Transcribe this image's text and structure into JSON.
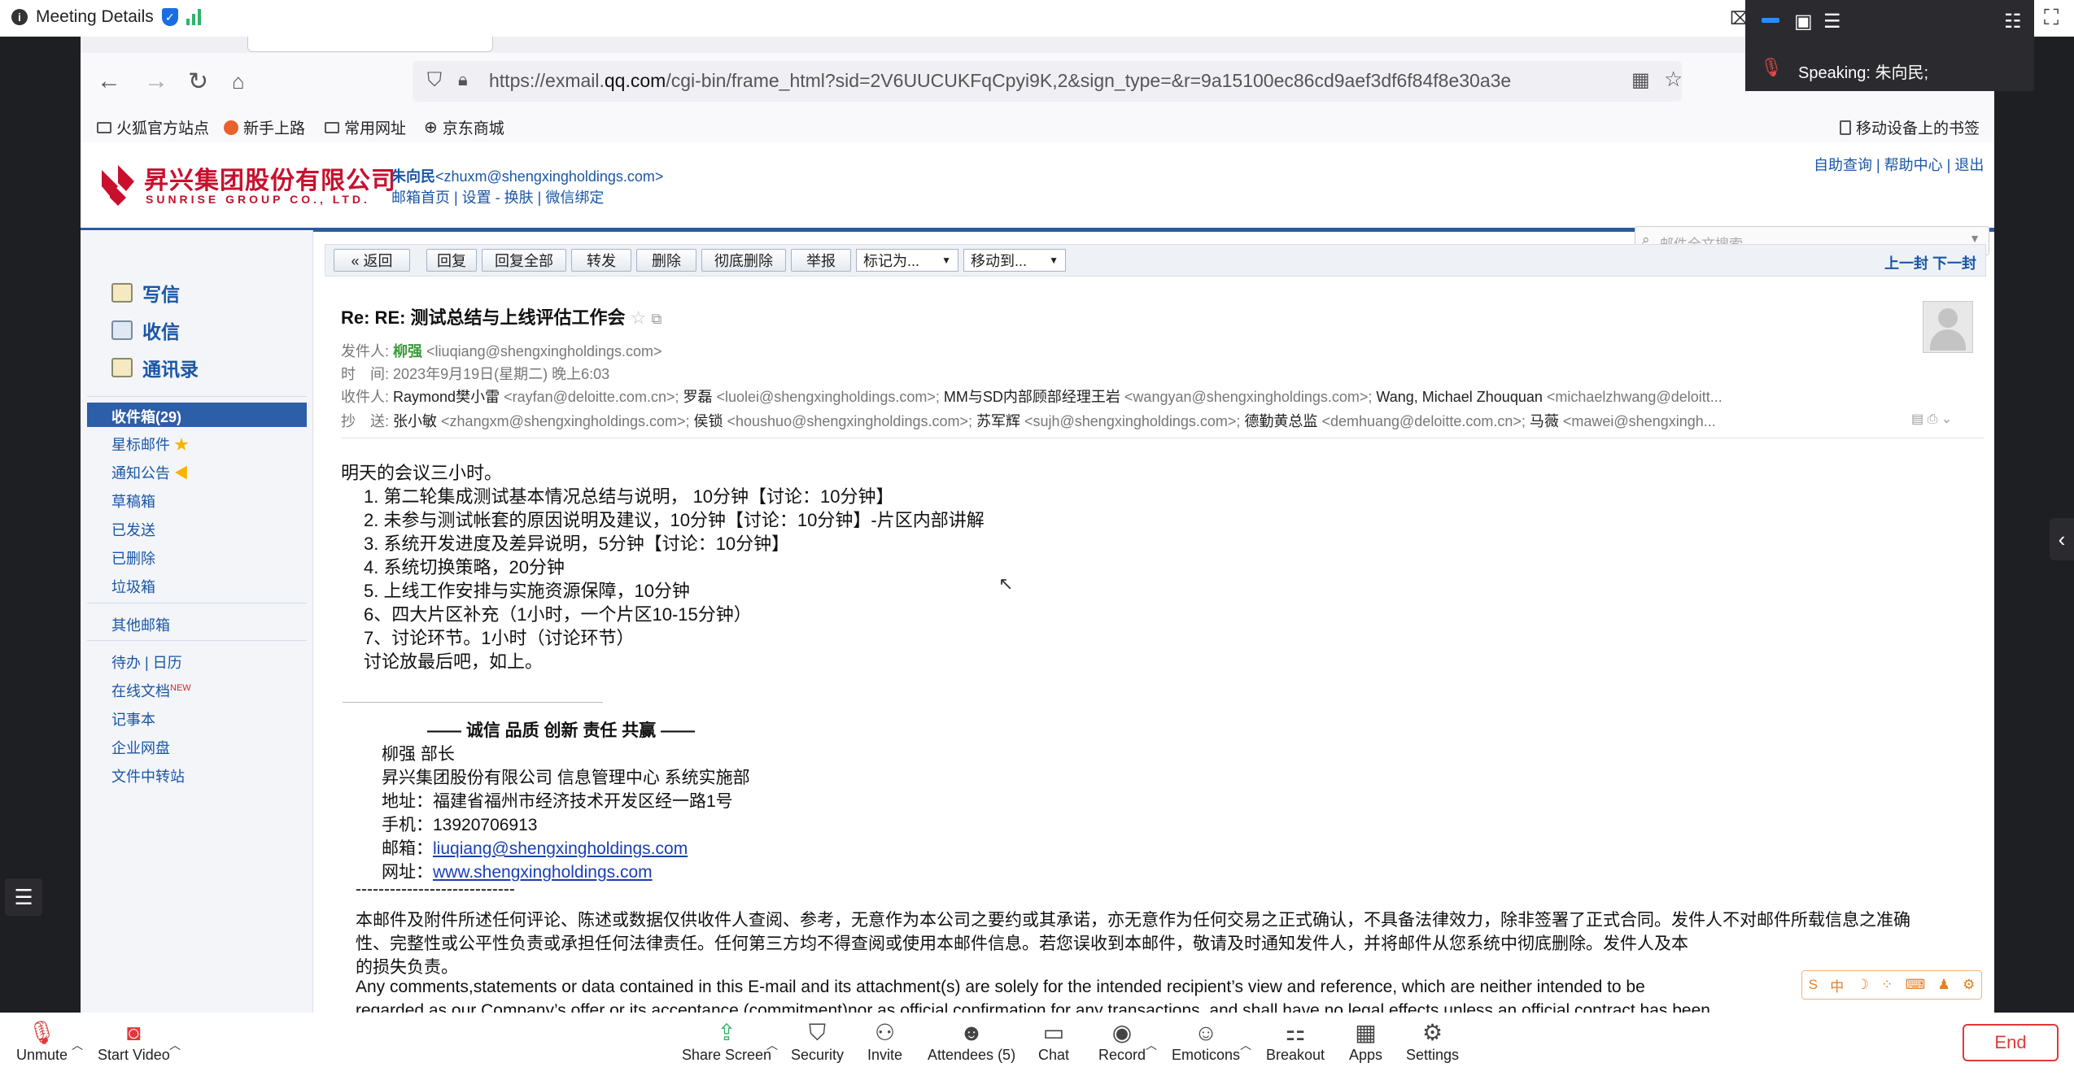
{
  "zoom": {
    "title": "Meeting Details",
    "speaking_label": "Speaking:",
    "speaking_name": "朱向民;",
    "bottom": {
      "unmute": "Unmute",
      "start_video": "Start Video",
      "share_screen": "Share Screen",
      "security": "Security",
      "invite": "Invite",
      "attendees": "Attendees (5)",
      "chat": "Chat",
      "record": "Record",
      "emoticons": "Emoticons",
      "breakout": "Breakout",
      "apps": "Apps",
      "settings": "Settings",
      "end": "End"
    },
    "colors": {
      "accent_green": "#2fb36b",
      "end_red": "#e03a3a"
    }
  },
  "browser": {
    "url_prefix": "https://exmail.",
    "url_domain": "qq.com",
    "url_rest": "/cgi-bin/frame_html?sid=2V6UUCUKFqCpyi9K,2&sign_type=&r=9a15100ec86cd9aef3df6f84f8e30a3e",
    "bookmarks": [
      "火狐官方站点",
      "新手上路",
      "常用网址",
      "京东商城"
    ],
    "mobile_bookmarks": "移动设备上的书签"
  },
  "mail": {
    "logo_cn": "昇兴集团股份有限公司",
    "logo_en": "SUNRISE GROUP CO., LTD.",
    "user_name": "朱向民",
    "user_email": "<zhuxm@shengxingholdings.com>",
    "user_links": "邮箱首页 | 设置 - 换肤 | 微信绑定",
    "top_links": "自助查询 | 帮助中心 | 退出",
    "search_placeholder": "邮件全文搜索...",
    "sidebar": {
      "compose": "写信",
      "receive": "收信",
      "contacts": "通讯录",
      "inbox": "收件箱(29)",
      "starred": "星标邮件",
      "notices": "通知公告",
      "drafts": "草稿箱",
      "sent": "已发送",
      "deleted": "已删除",
      "spam": "垃圾箱",
      "other": "其他邮箱",
      "todo_calendar": "待办 | 日历",
      "online_docs": "在线文档",
      "new_badge": "NEW",
      "notes": "记事本",
      "disk": "企业网盘",
      "transfer": "文件中转站"
    },
    "toolbar": {
      "back": "« 返回",
      "reply": "回复",
      "reply_all": "回复全部",
      "forward": "转发",
      "delete": "删除",
      "delete_perm": "彻底删除",
      "report": "举报",
      "mark_as": "标记为...",
      "move_to": "移动到...",
      "prev_next": "上一封 下一封"
    },
    "subject": "Re: RE:  测试总结与上线评估工作会",
    "from_label": "发件人:",
    "from_name": "柳强",
    "from_email": "<liuqiang@shengxingholdings.com>",
    "time_label": "时　间:",
    "time_value": "2023年9月19日(星期二) 晚上6:03",
    "to_label": "收件人:",
    "to_value_1": "Raymond樊小雷",
    "to_value_1e": " <rayfan@deloitte.com.cn>; ",
    "to_value_2": "罗磊",
    "to_value_2e": " <luolei@shengxingholdings.com>; ",
    "to_value_3": "MM与SD内部顾部经理王岩",
    "to_value_3e": " <wangyan@shengxingholdings.com>; ",
    "to_value_4": "Wang, Michael Zhouquan",
    "to_value_4e": " <michaelzhwang@deloitt...",
    "cc_label": "抄　送:",
    "cc_value_1": "张小敏",
    "cc_value_1e": " <zhangxm@shengxingholdings.com>; ",
    "cc_value_2": "侯锁",
    "cc_value_2e": " <houshuo@shengxingholdings.com>; ",
    "cc_value_3": "苏军辉",
    "cc_value_3e": " <sujh@shengxingholdings.com>; ",
    "cc_value_4": "德勤黄总监",
    "cc_value_4e": " <demhuang@deloitte.com.cn>; ",
    "cc_value_5": "马薇",
    "cc_value_5e": " <mawei@shengxingh...",
    "body": [
      "明天的会议三小时。",
      "1.  第二轮集成测试基本情况总结与说明， 10分钟【讨论：10分钟】",
      "2.  未参与测试帐套的原因说明及建议，10分钟【讨论：10分钟】-片区内部讲解",
      "3.  系统开发进度及差异说明，5分钟【讨论：10分钟】",
      "4.  系统切换策略，20分钟",
      "5.  上线工作安排与实施资源保障，10分钟",
      "6、四大片区补充（1小时，一个片区10-15分钟）",
      " 7、讨论环节。1小时（讨论环节）",
      "讨论放最后吧，如上。"
    ],
    "signature": {
      "motto": "—— 诚信  品质  创新  责任  共赢 ——",
      "name": "柳强  部长",
      "company": "昇兴集团股份有限公司  信息管理中心 系统实施部",
      "address": "地址：福建省福州市经济技术开发区经一路1号",
      "phone": "手机：13920706913",
      "email_label": "邮箱：",
      "email": "liuqiang@shengxingholdings.com",
      "web_label": "网址：",
      "web": "www.shengxingholdings.com",
      "dashes": "----------------------------"
    },
    "disclaimer_cn_1": "本邮件及附件所述任何评论、陈述或数据仅供收件人查阅、参考，无意作为本公司之要约或其承诺，亦无意作为任何交易之正式确认，不具备法律效力，除非签署了正式合同。发件人不对邮件所载信息之准确",
    "disclaimer_cn_2": "性、完整性或公平性负责或承担任何法律责任。任何第三方均不得查阅或使用本邮件信息。若您误收到本邮件，敬请及时通知发件人，并将邮件从您系统中彻底删除。发件人及本",
    "disclaimer_cn_2b": "的损失负责。",
    "disclaimer_en_1": "Any comments,statements or data contained in this E-mail and its attachment(s) are solely for the intended recipient’s view and reference, which are neither intended to be",
    "disclaimer_en_2": "regarded as our Company’s offer or its acceptance (commitment)nor as official confirmation for any transactions, and shall have no legal effects unless an official contract has been",
    "ime_label": "中"
  }
}
